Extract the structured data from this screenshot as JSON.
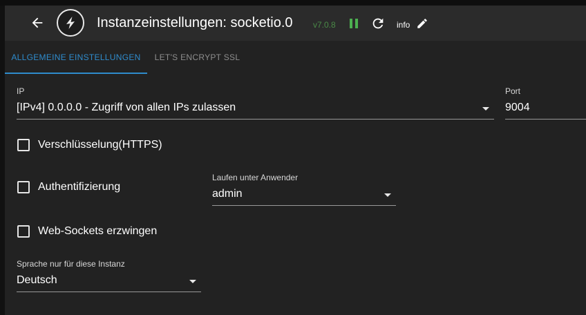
{
  "header": {
    "title": "Instanzeinstellungen: socketio.0",
    "version": "v7.0.8",
    "info_label": "info",
    "icons": {
      "back": "arrow-left-icon",
      "logo": "socketio-logo-icon",
      "pause": "pause-icon",
      "reload": "reload-icon",
      "edit": "pencil-icon"
    }
  },
  "tabs": [
    {
      "label": "ALLGEMEINE EINSTELLUNGEN",
      "active": true
    },
    {
      "label": "LET'S ENCRYPT SSL",
      "active": false
    }
  ],
  "form": {
    "ip": {
      "label": "IP",
      "value": "[IPv4] 0.0.0.0 - Zugriff von allen IPs zulassen"
    },
    "port": {
      "label": "Port",
      "value": "9004"
    },
    "encryption": {
      "label": "Verschlüsselung(HTTPS)",
      "checked": false
    },
    "auth": {
      "label": "Authentifizierung",
      "checked": false
    },
    "run_as_user": {
      "label": "Laufen unter Anwender",
      "value": "admin"
    },
    "force_websockets": {
      "label": "Web-Sockets erzwingen",
      "checked": false
    },
    "language": {
      "label": "Sprache nur für diese Instanz",
      "value": "Deutsch"
    }
  },
  "colors": {
    "accent": "#2f8ccd",
    "version": "#4a8a47",
    "pause": "#4caf50",
    "background": "#222222",
    "header": "#2b2b2b"
  }
}
